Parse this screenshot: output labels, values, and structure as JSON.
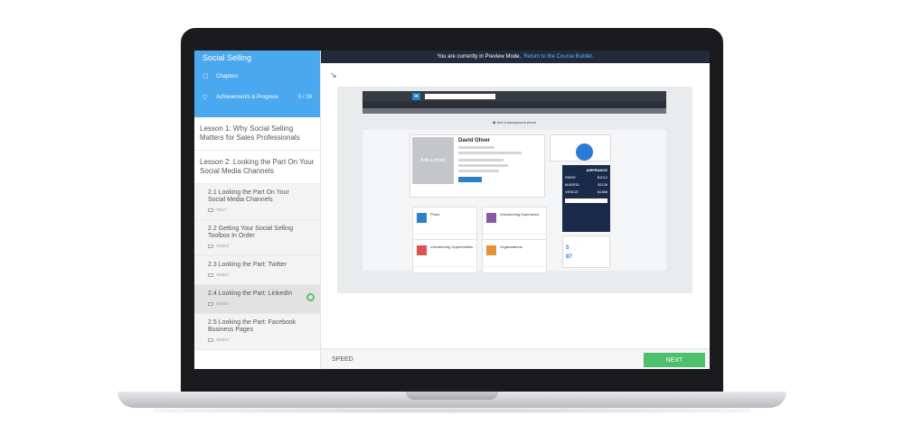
{
  "sidebar": {
    "title": "Social Selling",
    "chapters_label": "Chapters",
    "achievements_label": "Achievements & Progress",
    "achievements_count": "0 / 28",
    "lessons": [
      {
        "title": "Lesson 1: Why Social Selling Matters for Sales Professionals"
      },
      {
        "title": "Lesson 2: Looking the Part On Your Social Media Channels"
      }
    ],
    "subitems": [
      {
        "title": "2.1 Looking the Part On Your Social Media Channels",
        "type": "TEXT"
      },
      {
        "title": "2.2 Getting Your Social Selling Toolbox In Order",
        "type": "VIDEO"
      },
      {
        "title": "2.3 Looking the Part: Twitter",
        "type": "VIDEO"
      },
      {
        "title": "2.4 Looking the Part: LinkedIn",
        "type": "VIDEO"
      },
      {
        "title": "2.5 Looking the Part: Facebook Business Pages",
        "type": "VIDEO"
      }
    ]
  },
  "topbar": {
    "text": "You are currently in Preview Mode.",
    "link": "Return to the Course Builder."
  },
  "preview": {
    "logo": "in",
    "add_photo_banner": "Add a background photo",
    "avatar_text": "Add a photo",
    "profile_name": "David Oliver",
    "tiles": [
      {
        "title": "Photo"
      },
      {
        "title": "Volunteering Experience"
      },
      {
        "title": "Volunteering Opportunities"
      },
      {
        "title": "Organizations"
      }
    ],
    "ad": {
      "brand": "AIRFRANCE",
      "rows": [
        {
          "city": "PARIS",
          "price": "$1012"
        },
        {
          "city": "MADRID",
          "price": "$1136"
        },
        {
          "city": "VENICE",
          "price": "$1388"
        }
      ]
    },
    "stats": [
      "5",
      "87"
    ]
  },
  "footer": {
    "speed_label": "SPEED",
    "next_label": "NEXT"
  },
  "colors": {
    "accent_blue": "#4aa8ee",
    "topbar_dark": "#232a3b",
    "next_green": "#4dbf6d",
    "linkedin_blue": "#1b86c9"
  }
}
